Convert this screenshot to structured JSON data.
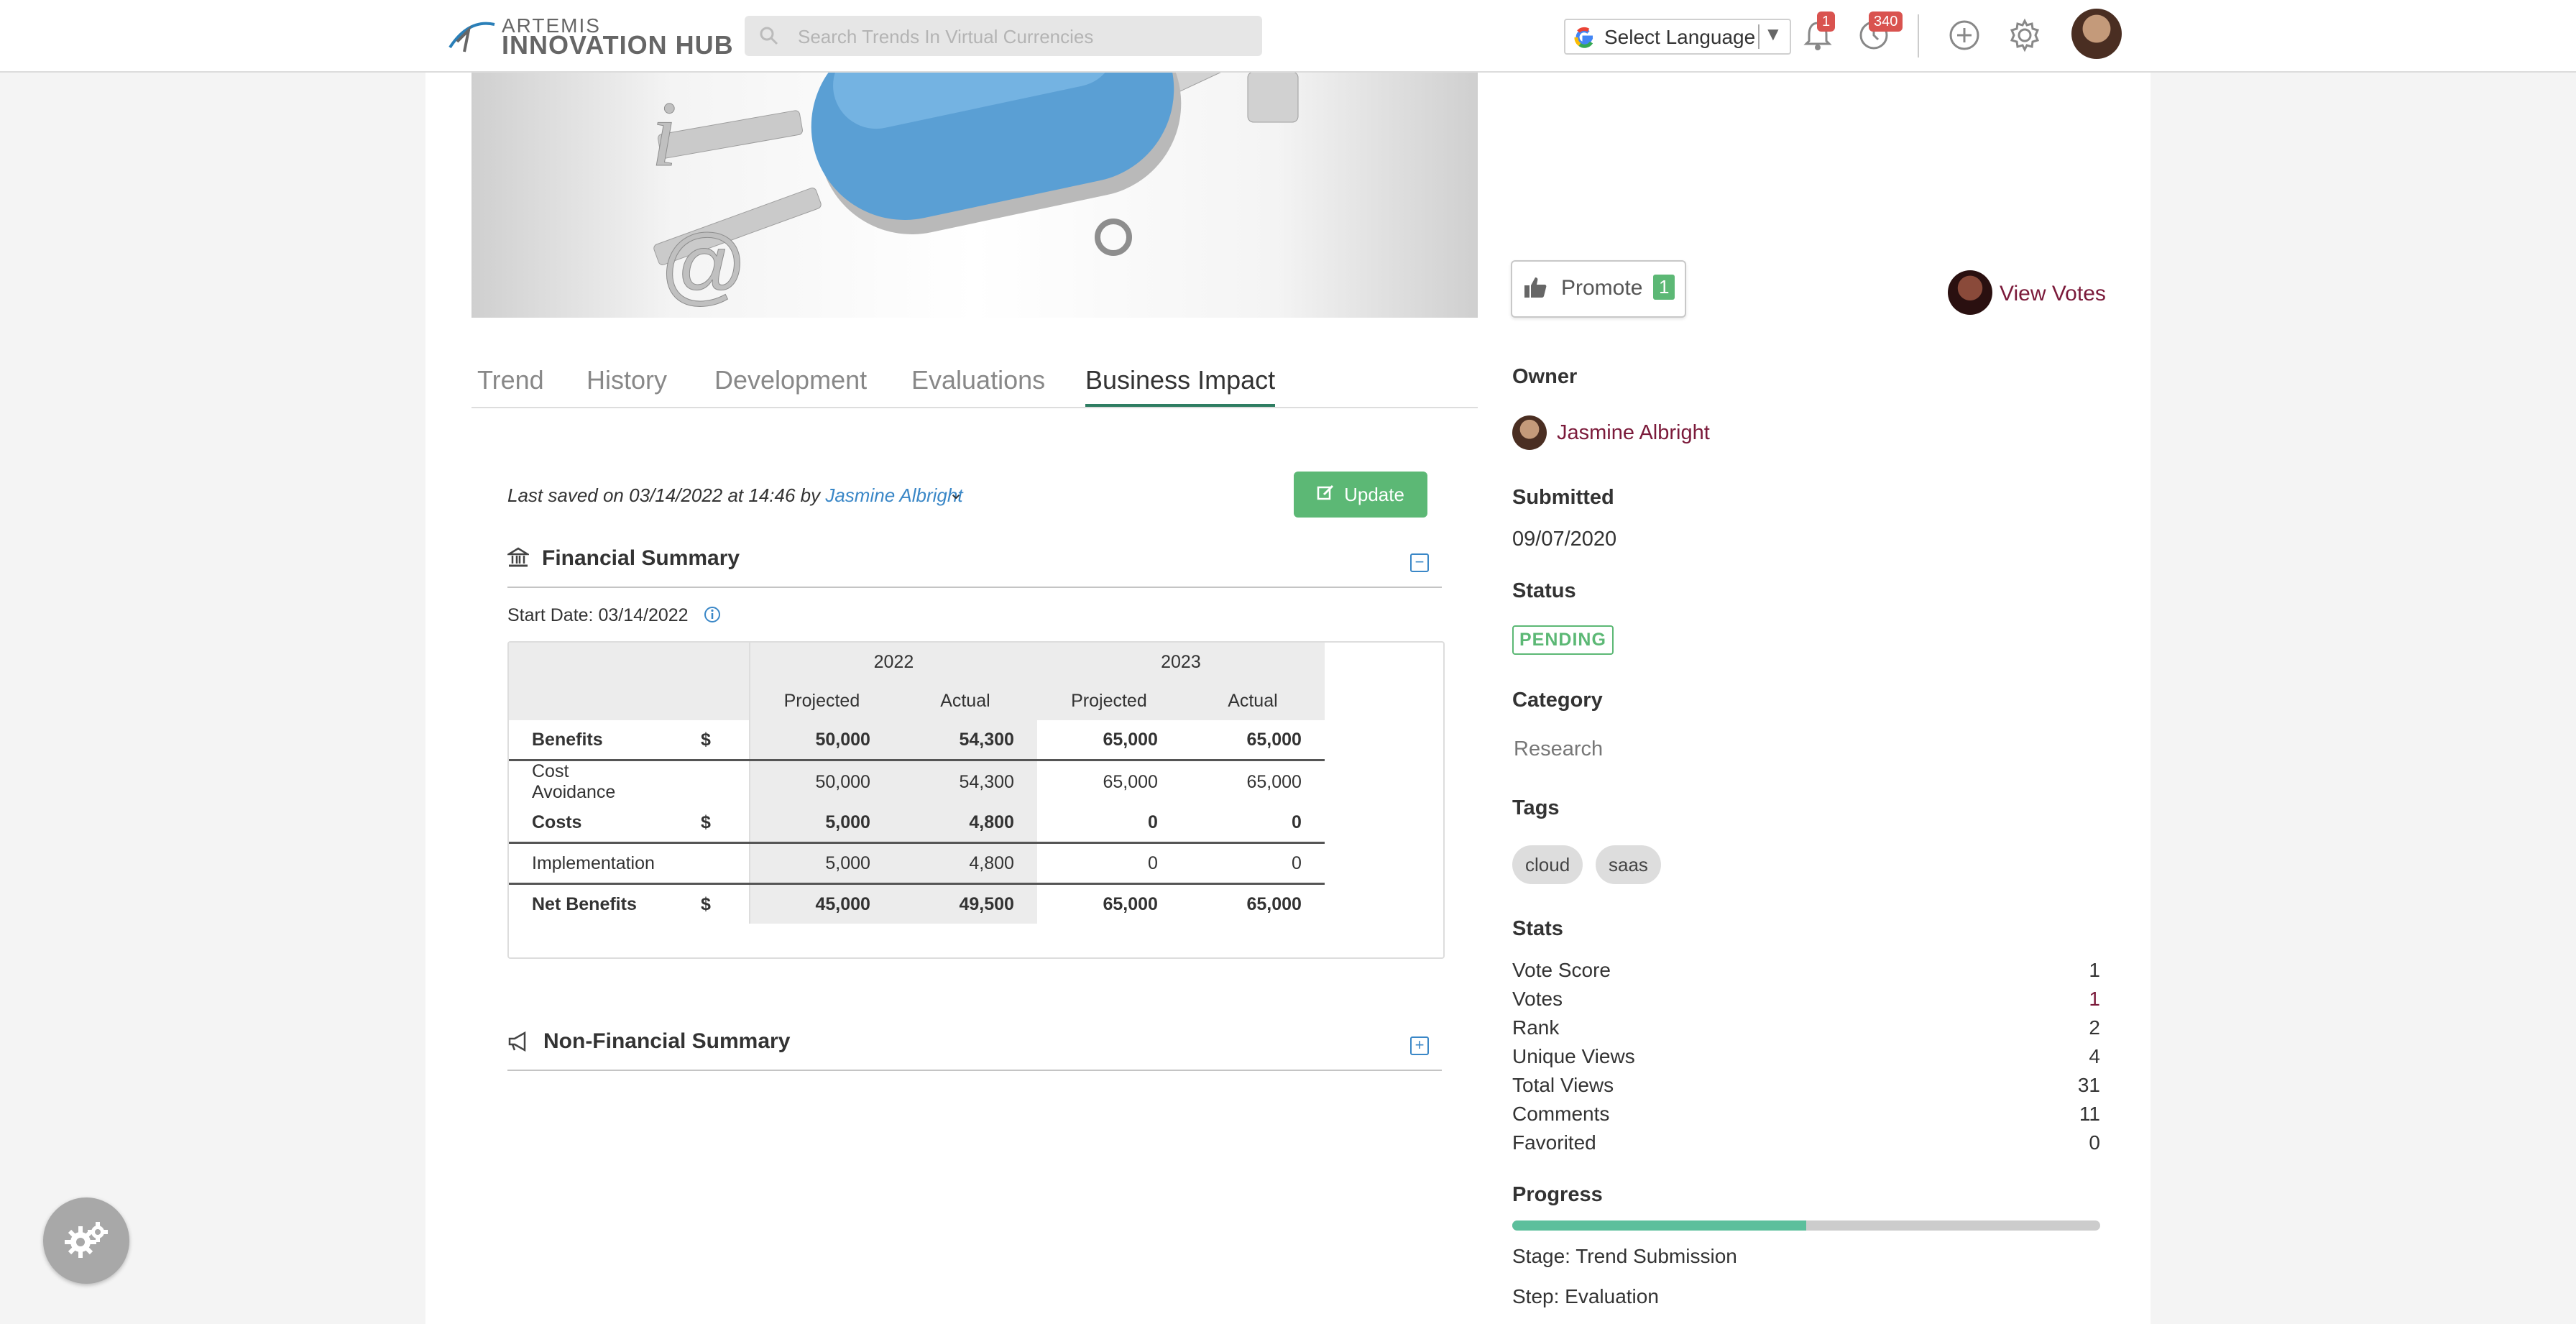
{
  "header": {
    "logo_top": "ARTEMIS",
    "logo_bottom": "INNOVATION HUB",
    "search_placeholder": "Search Trends In Virtual Currencies",
    "language_label": "Select Language",
    "notifications_count": "1",
    "activity_count": "340"
  },
  "tabs": [
    {
      "label": "Trend"
    },
    {
      "label": "History"
    },
    {
      "label": "Development"
    },
    {
      "label": "Evaluations"
    },
    {
      "label": "Business Impact",
      "active": true
    }
  ],
  "last_saved": {
    "prefix": "Last saved on 03/14/2022 at 14:46 by ",
    "user": "Jasmine Albright"
  },
  "update_label": "Update",
  "financial_summary": {
    "title": "Financial Summary",
    "start_date": "Start Date: 03/14/2022",
    "years": [
      "2022",
      "2023"
    ],
    "col_headers": [
      "Projected",
      "Actual",
      "Projected",
      "Actual"
    ],
    "rows": [
      {
        "label": "Benefits",
        "currency": "$",
        "values": [
          "50,000",
          "54,300",
          "65,000",
          "65,000"
        ],
        "bold": true
      },
      {
        "label": "Cost Avoidance",
        "currency": "",
        "values": [
          "50,000",
          "54,300",
          "65,000",
          "65,000"
        ],
        "bold": false
      },
      {
        "label": "Costs",
        "currency": "$",
        "values": [
          "5,000",
          "4,800",
          "0",
          "0"
        ],
        "bold": true
      },
      {
        "label": "Implementation",
        "currency": "",
        "values": [
          "5,000",
          "4,800",
          "0",
          "0"
        ],
        "bold": false
      },
      {
        "label": "Net Benefits",
        "currency": "$",
        "values": [
          "45,000",
          "49,500",
          "65,000",
          "65,000"
        ],
        "bold": true
      }
    ]
  },
  "non_financial_summary": {
    "title": "Non-Financial Summary"
  },
  "sidebar": {
    "promote_label": "Promote",
    "promote_count": "1",
    "view_votes": "View Votes",
    "owner_label": "Owner",
    "owner_name": "Jasmine Albright",
    "submitted_label": "Submitted",
    "submitted_date": "09/07/2020",
    "status_label": "Status",
    "status_value": "PENDING",
    "category_label": "Category",
    "category_value": "Research",
    "tags_label": "Tags",
    "tags": [
      "cloud",
      "saas"
    ],
    "stats_label": "Stats",
    "stats": [
      {
        "label": "Vote Score",
        "value": "1"
      },
      {
        "label": "Votes",
        "value": "1"
      },
      {
        "label": "Rank",
        "value": "2"
      },
      {
        "label": "Unique Views",
        "value": "4"
      },
      {
        "label": "Total Views",
        "value": "31"
      },
      {
        "label": "Comments",
        "value": "11"
      },
      {
        "label": "Favorited",
        "value": "0"
      }
    ],
    "progress_label": "Progress",
    "progress_fraction": 0.5,
    "stage": "Stage: Trend Submission",
    "step": "Step: Evaluation"
  },
  "colors": {
    "accent_green": "#5cb875",
    "link_maroon": "#7b1a3a",
    "link_blue": "#3a87c7",
    "badge_red": "#d9534f"
  }
}
